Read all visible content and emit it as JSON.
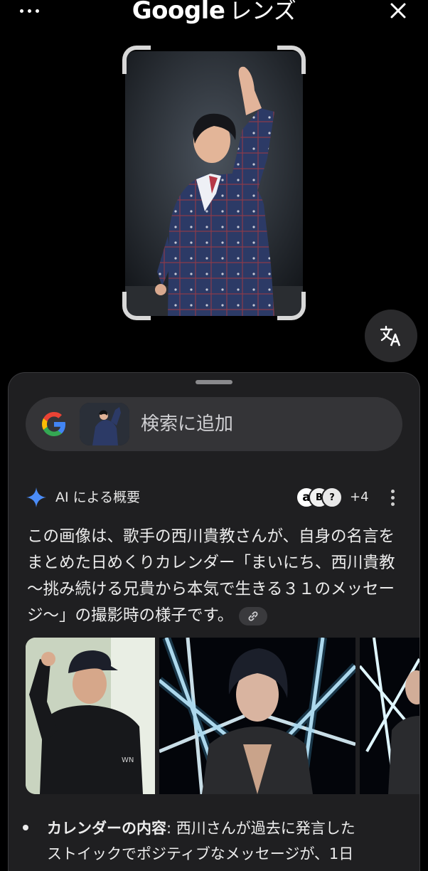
{
  "app": {
    "title_brand": "Google",
    "title_suffix": "レンズ"
  },
  "search_bar": {
    "label": "検索に追加"
  },
  "ai_overview": {
    "title": "AI による概要",
    "source_badges": [
      "a",
      "B",
      "?"
    ],
    "more_sources": "+4",
    "summary": "この画像は、歌手の西川貴教さんが、自身の名言をまとめた日めくりカレンダー「まいにち、西川貴教 〜挑み続ける兄貴から本気で生きる３１のメッセージ〜」の撮影時の様子です。",
    "bullet_label": "カレンダーの内容",
    "bullet_text": ": 西川さんが過去に発言した",
    "bullet_line2": "ストイックでポジティブなメッセージが、1日"
  },
  "icons": {
    "more": "more-horizontal-icon",
    "close": "close-icon",
    "translate": "translate-icon",
    "google": "google-g-icon",
    "sparkle": "gemini-sparkle-icon",
    "link": "link-icon",
    "kebab": "more-vertical-icon"
  },
  "colors": {
    "background": "#000000",
    "sheet": "#1f1f21",
    "pill": "#343437",
    "sparkle": "#4b8cf7"
  }
}
